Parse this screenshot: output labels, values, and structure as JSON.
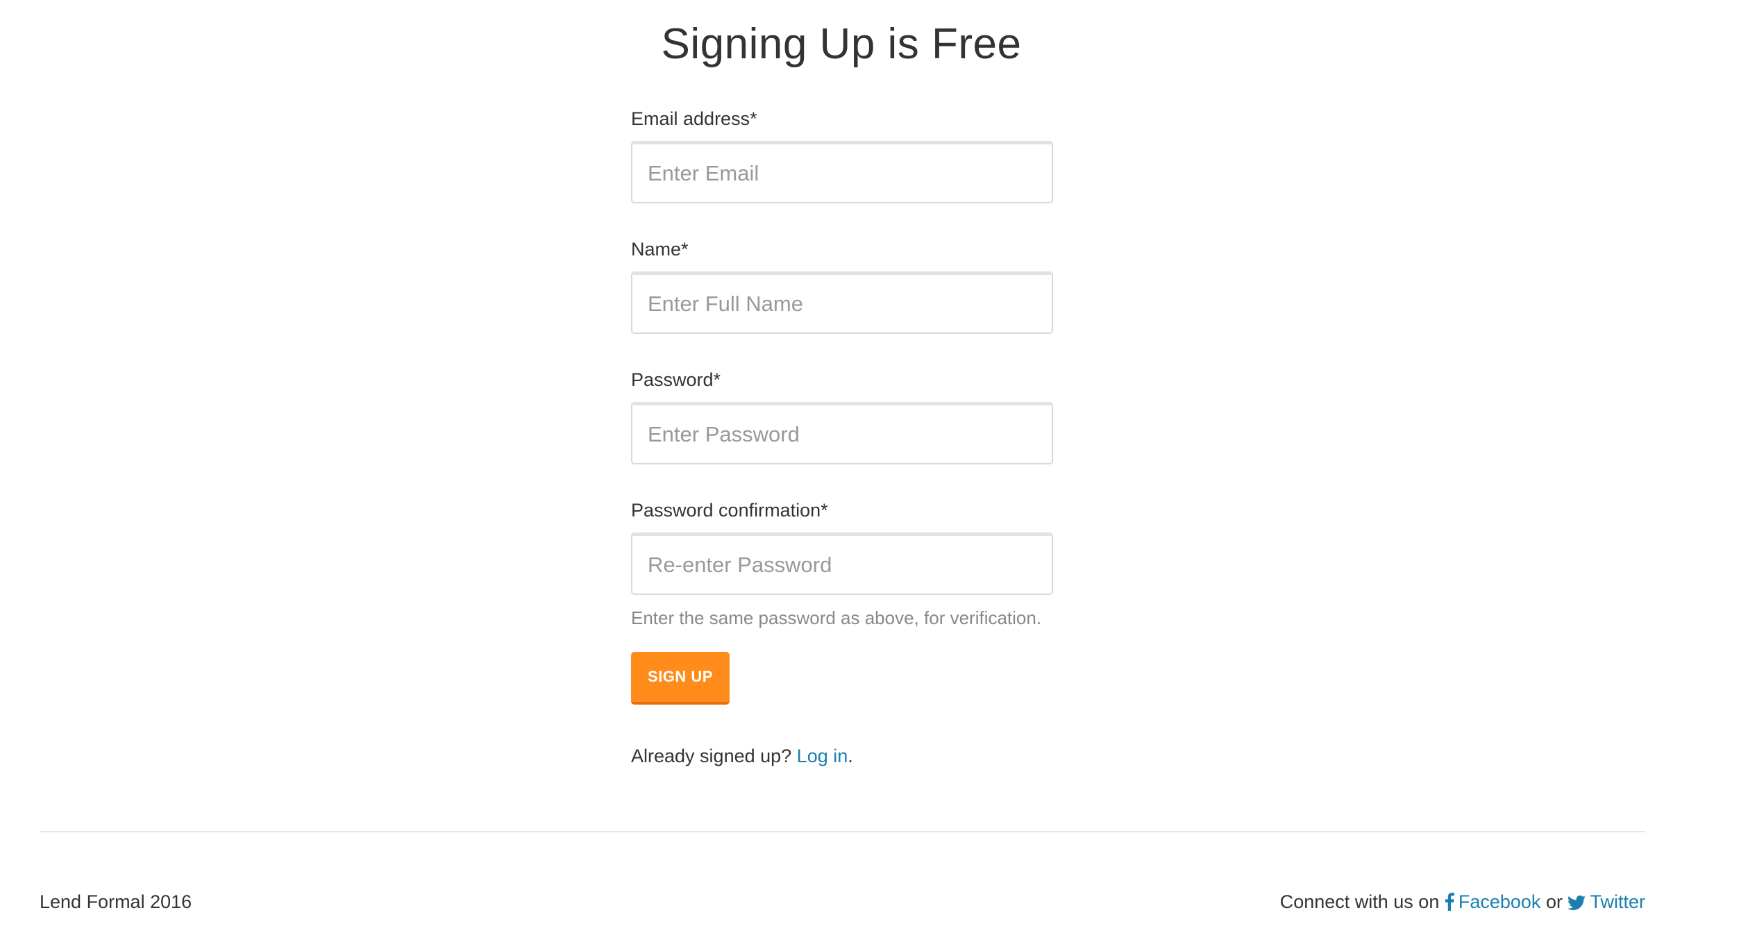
{
  "page": {
    "title": "Signing Up is Free"
  },
  "form": {
    "email": {
      "label": "Email address*",
      "placeholder": "Enter Email",
      "value": ""
    },
    "name": {
      "label": "Name*",
      "placeholder": "Enter Full Name",
      "value": ""
    },
    "password": {
      "label": "Password*",
      "placeholder": "Enter Password",
      "value": ""
    },
    "password_confirmation": {
      "label": "Password confirmation*",
      "placeholder": "Re-enter Password",
      "value": "",
      "help_text": "Enter the same password as above, for verification."
    },
    "submit_label": "SIGN UP"
  },
  "login_prompt": {
    "text": "Already signed up?",
    "link_label": "Log in",
    "suffix": "."
  },
  "footer": {
    "copyright": "Lend Formal 2016",
    "connect_text": "Connect with us on",
    "facebook_label": "Facebook",
    "or_text": "or",
    "twitter_label": "Twitter",
    "facebook_icon": "facebook-icon",
    "twitter_icon": "twitter-icon"
  },
  "colors": {
    "accent": "#ff8c1a",
    "link": "#1a7fb0",
    "text": "#333333",
    "muted": "#888888"
  }
}
